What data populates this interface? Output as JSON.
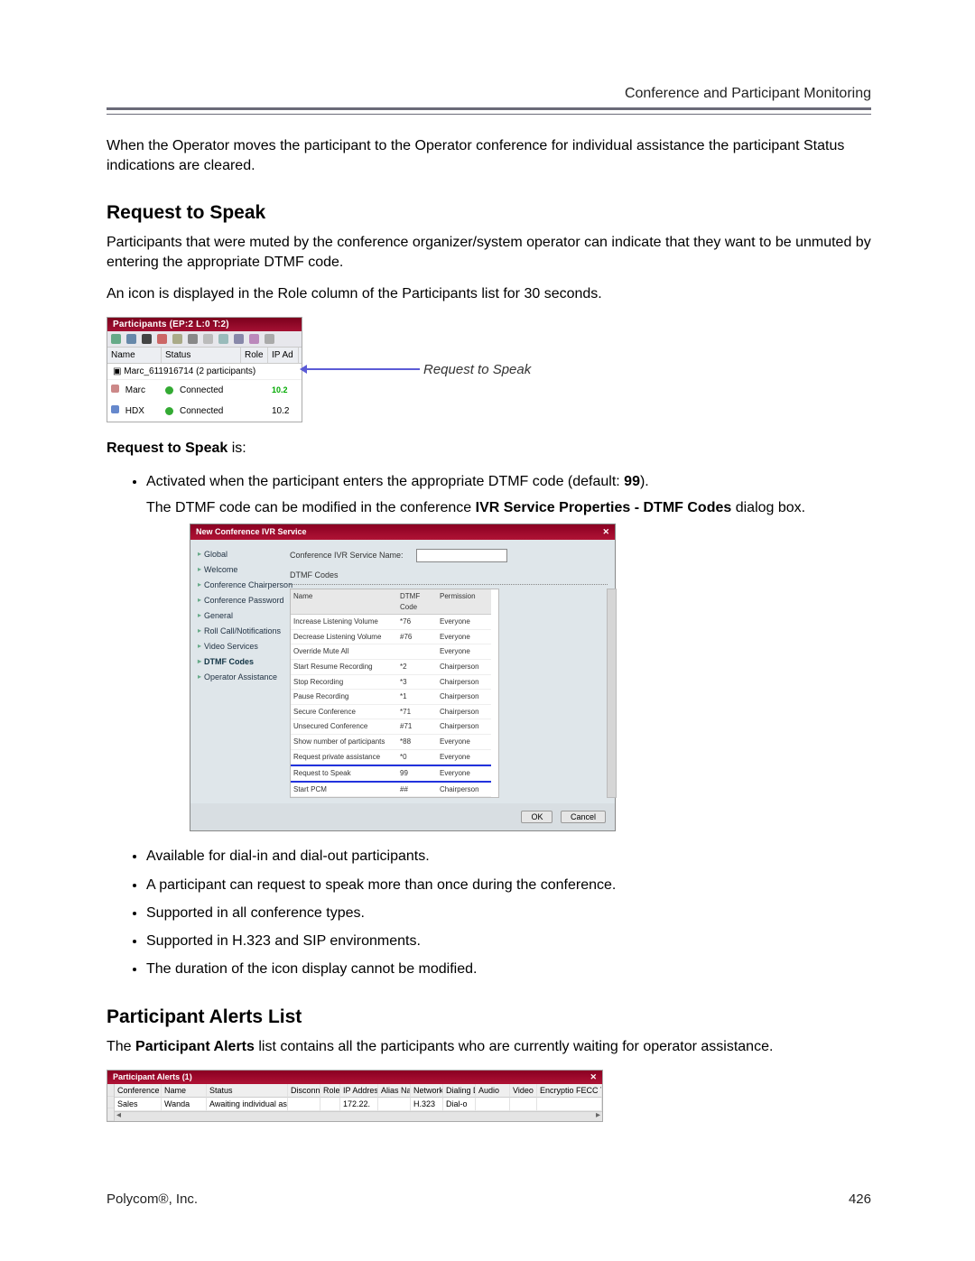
{
  "header": {
    "right": "Conference and Participant Monitoring"
  },
  "intro_paragraph": "When the Operator moves the participant to the Operator conference for individual assistance the participant Status indications are cleared.",
  "section_rts": {
    "heading": "Request to Speak",
    "p1": "Participants that were muted by the conference organizer/system operator can indicate that they want to be unmuted by entering the appropriate DTMF code.",
    "p2": "An icon is displayed in the Role column of the Participants list for 30 seconds.",
    "callout": "Request to Speak",
    "lead_in": "Request to Speak is:",
    "bullets": {
      "b1_prefix": "Activated when the participant enters the appropriate DTMF code (default: ",
      "b1_code": "99",
      "b1_suffix": ").",
      "b1b_prefix": "The DTMF code can be modified in the conference ",
      "b1b_bold": "IVR Service Properties - DTMF Codes",
      "b1b_suffix": " dialog box.",
      "b2": "Available for dial-in and dial-out participants.",
      "b3": "A participant can request to speak more than once during the conference.",
      "b4": "Supported in all conference types.",
      "b5": "Supported in H.323 and SIP environments.",
      "b6": "The duration of the icon display cannot be modified."
    }
  },
  "participants_pane": {
    "title": "Participants (EP:2 L:0 T:2)",
    "columns": {
      "c1": "Name",
      "c2": "Status",
      "c3": "Role",
      "c4": "IP Ad"
    },
    "group_label": "Marc_611916714 (2 participants)",
    "rows": [
      {
        "name": "Marc",
        "status": "Connected",
        "role_ip": "10.2",
        "ip2": ""
      },
      {
        "name": "HDX",
        "status": "Connected",
        "role_ip": "",
        "ip2": "10.2"
      }
    ]
  },
  "ivr_dialog": {
    "title": "New Conference IVR Service",
    "nav": [
      "Global",
      "Welcome",
      "Conference Chairperson",
      "Conference Password",
      "General",
      "Roll Call/Notifications",
      "Video Services",
      "DTMF Codes",
      "Operator Assistance"
    ],
    "field_label": "Conference IVR Service Name:",
    "group_label": "DTMF Codes",
    "columns": {
      "c1": "Name",
      "c2": "DTMF Code",
      "c3": "Permission"
    },
    "rows": [
      {
        "n": "Increase Listening Volume",
        "c": "*76",
        "p": "Everyone"
      },
      {
        "n": "Decrease Listening Volume",
        "c": "#76",
        "p": "Everyone"
      },
      {
        "n": "Override Mute All",
        "c": "",
        "p": "Everyone"
      },
      {
        "n": "Start Resume Recording",
        "c": "*2",
        "p": "Chairperson"
      },
      {
        "n": "Stop Recording",
        "c": "*3",
        "p": "Chairperson"
      },
      {
        "n": "Pause Recording",
        "c": "*1",
        "p": "Chairperson"
      },
      {
        "n": "Secure Conference",
        "c": "*71",
        "p": "Chairperson"
      },
      {
        "n": "Unsecured Conference",
        "c": "#71",
        "p": "Chairperson"
      },
      {
        "n": "Show number of participants",
        "c": "*88",
        "p": "Everyone"
      },
      {
        "n": "Request private assistance",
        "c": "*0",
        "p": "Everyone"
      },
      {
        "n": "Request to Speak",
        "c": "99",
        "p": "Everyone"
      },
      {
        "n": "Start PCM",
        "c": "##",
        "p": "Chairperson"
      }
    ],
    "buttons": {
      "ok": "OK",
      "cancel": "Cancel"
    }
  },
  "section_alerts": {
    "heading": "Participant Alerts List",
    "p_prefix": "The ",
    "p_bold": "Participant Alerts",
    "p_suffix": " list contains all the participants who are currently waiting for operator assistance."
  },
  "alerts_pane": {
    "title": "Participant Alerts (1)",
    "columns": [
      "Conference",
      "Name",
      "Status",
      "Disconne",
      "Role",
      "IP Addres",
      "Alias Na",
      "Network",
      "Dialing Di",
      "Audio",
      "Video",
      "Encryptio FECC Tok Con"
    ],
    "row": {
      "conf": "Sales",
      "name": "Wanda",
      "status": "Awaiting individual assist",
      "disc": "",
      "role": "",
      "ip": "172.22.",
      "alias": "",
      "net": "H.323",
      "dial": "Dial-o",
      "audio": "",
      "video": "",
      "rest": ""
    }
  },
  "footer": {
    "left": "Polycom®, Inc.",
    "right": "426"
  }
}
